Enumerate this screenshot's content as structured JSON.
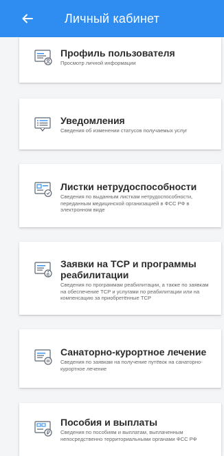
{
  "header": {
    "title": "Личный кабинет",
    "back_icon": "arrow-left-icon",
    "background_color": "#2f8cf0"
  },
  "cards": [
    {
      "title": "Профиль пользователя",
      "description": "Просмотр личной информации",
      "icon": "user-profile-icon"
    },
    {
      "title": "Уведомления",
      "description": "Сведения об изменении статусов получаемых услуг",
      "icon": "notification-icon"
    },
    {
      "title": "Листки нетрудоспособности",
      "description": "Сведения по выданным листкам нетрудоспособности, переданным медицинской организацией в ФСС РФ в электронном виде",
      "icon": "sick-leave-icon"
    },
    {
      "title": "Заявки на ТСР и программы реабилитации",
      "description": "Сведения по программам реабилитации, а также по заявкам на обеспечение ТСР и услугами по реабилитации или на компенсацию за приобретённые ТСР",
      "icon": "rehabilitation-icon"
    },
    {
      "title": "Санаторно-курортное лечение",
      "description": "Сведения по заявкам на получение путёвок на санаторно-курортное лечение",
      "icon": "sanatorium-icon"
    },
    {
      "title": "Пособия и выплаты",
      "description": "Сведения по пособиям и выплатам, выплаченным непосредственно территориальными органами ФСС РФ",
      "icon": "payments-icon"
    }
  ]
}
